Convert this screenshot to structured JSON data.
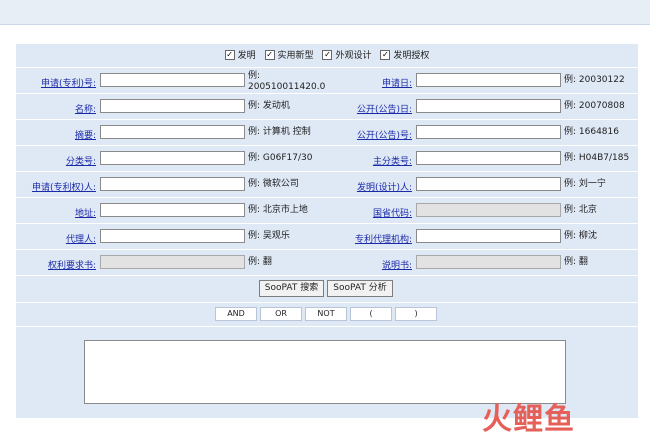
{
  "types": [
    {
      "label": "发明",
      "checked": true
    },
    {
      "label": "实用新型",
      "checked": true
    },
    {
      "label": "外观设计",
      "checked": true
    },
    {
      "label": "发明授权",
      "checked": true
    }
  ],
  "fields_left": [
    {
      "label": "申请(专利)号:",
      "example": "例: 200510011420.0",
      "disabled": false
    },
    {
      "label": "名称:",
      "example": "例: 发动机",
      "disabled": false
    },
    {
      "label": "摘要:",
      "example": "例: 计算机 控制",
      "disabled": false
    },
    {
      "label": "分类号:",
      "example": "例: G06F17/30",
      "disabled": false
    },
    {
      "label": "申请(专利权)人:",
      "example": "例: 微软公司",
      "disabled": false
    },
    {
      "label": "地址:",
      "example": "例: 北京市上地",
      "disabled": false
    },
    {
      "label": "代理人:",
      "example": "例: 吴观乐",
      "disabled": false
    },
    {
      "label": "权利要求书:",
      "example": "例: 翻",
      "disabled": true
    }
  ],
  "fields_right": [
    {
      "label": "申请日:",
      "example": "例: 20030122",
      "disabled": false
    },
    {
      "label": "公开(公告)日:",
      "example": "例: 20070808",
      "disabled": false
    },
    {
      "label": "公开(公告)号:",
      "example": "例: 1664816",
      "disabled": false
    },
    {
      "label": "主分类号:",
      "example": "例: H04B7/185",
      "disabled": false
    },
    {
      "label": "发明(设计)人:",
      "example": "例: 刘一宁",
      "disabled": false
    },
    {
      "label": "国省代码:",
      "example": "例: 北京",
      "disabled": true
    },
    {
      "label": "专利代理机构:",
      "example": "例: 柳沈",
      "disabled": false
    },
    {
      "label": "说明书:",
      "example": "例: 翻",
      "disabled": true
    }
  ],
  "buttons": {
    "search": "SooPAT 搜索",
    "analyze": "SooPAT 分析"
  },
  "operators": [
    "AND",
    "OR",
    "NOT",
    "(",
    ")"
  ],
  "logo": "火鲤鱼"
}
